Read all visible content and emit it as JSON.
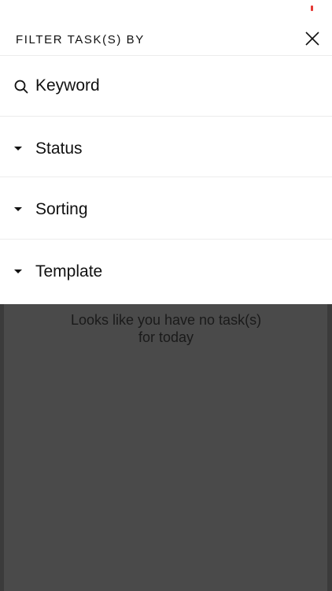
{
  "header": {
    "title": "FILTER TASK(S) BY"
  },
  "filters": {
    "keyword": {
      "label": "Keyword"
    },
    "status": {
      "label": "Status"
    },
    "sorting": {
      "label": "Sorting"
    },
    "template": {
      "label": "Template"
    }
  },
  "background": {
    "empty_line1": "Looks like you have no task(s)",
    "empty_line2": "for today"
  },
  "icons": {
    "close": "close-icon",
    "search": "search-icon",
    "caret": "caret-down-icon"
  },
  "colors": {
    "status_indicator": "#e53935",
    "overlay": "#4a4a4a"
  }
}
